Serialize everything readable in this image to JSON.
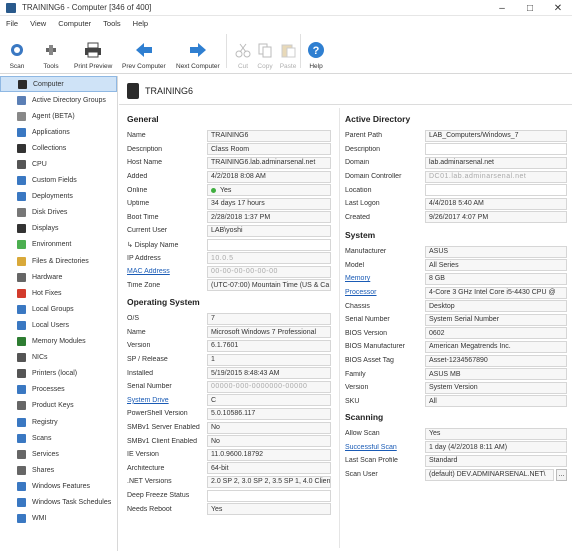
{
  "window": {
    "title": "TRAINING6 - Computer [346 of 400]",
    "minimize": "–",
    "maximize": "□",
    "close": "✕"
  },
  "menu": [
    "File",
    "View",
    "Computer",
    "Tools",
    "Help"
  ],
  "ribbon": {
    "scan": "Scan",
    "tools": "Tools",
    "print_preview": "Print Preview",
    "prev": "Prev Computer",
    "next": "Next Computer",
    "cut": "Cut",
    "copy": "Copy",
    "paste": "Paste",
    "help": "Help"
  },
  "sidebar": {
    "items": [
      {
        "label": "Computer",
        "color": "#2b2b2b"
      },
      {
        "label": "Active Directory Groups",
        "color": "#5b7fb5"
      },
      {
        "label": "Agent (BETA)",
        "color": "#888888"
      },
      {
        "label": "Applications",
        "color": "#3a78c2"
      },
      {
        "label": "Collections",
        "color": "#333333"
      },
      {
        "label": "CPU",
        "color": "#555555"
      },
      {
        "label": "Custom Fields",
        "color": "#3a78c2"
      },
      {
        "label": "Deployments",
        "color": "#3a78c2"
      },
      {
        "label": "Disk Drives",
        "color": "#777777"
      },
      {
        "label": "Displays",
        "color": "#333333"
      },
      {
        "label": "Environment",
        "color": "#4caf50"
      },
      {
        "label": "Files & Directories",
        "color": "#d9a93a"
      },
      {
        "label": "Hardware",
        "color": "#666666"
      },
      {
        "label": "Hot Fixes",
        "color": "#d33b2c"
      },
      {
        "label": "Local Groups",
        "color": "#3a78c2"
      },
      {
        "label": "Local Users",
        "color": "#3a78c2"
      },
      {
        "label": "Memory Modules",
        "color": "#2e7d32"
      },
      {
        "label": "NICs",
        "color": "#555555"
      },
      {
        "label": "Printers (local)",
        "color": "#555555"
      },
      {
        "label": "Processes",
        "color": "#3a78c2"
      },
      {
        "label": "Product Keys",
        "color": "#666666"
      },
      {
        "label": "Registry",
        "color": "#3a78c2"
      },
      {
        "label": "Scans",
        "color": "#3a78c2"
      },
      {
        "label": "Services",
        "color": "#666666"
      },
      {
        "label": "Shares",
        "color": "#666666"
      },
      {
        "label": "Windows Features",
        "color": "#3a78c2"
      },
      {
        "label": "Windows Task Schedules",
        "color": "#3a78c2"
      },
      {
        "label": "WMI",
        "color": "#3a78c2"
      }
    ]
  },
  "header": {
    "computer_name": "TRAINING6"
  },
  "general": {
    "title": "General",
    "rows": [
      {
        "label": "Name",
        "value": "TRAINING6"
      },
      {
        "label": "Description",
        "value": "Class Room"
      },
      {
        "label": "Host Name",
        "value": "TRAINING6.lab.adminarsenal.net"
      },
      {
        "label": "Added",
        "value": "4/2/2018 8:08 AM"
      },
      {
        "label": "Online",
        "value": "Yes"
      },
      {
        "label": "Uptime",
        "value": "34 days 17 hours"
      },
      {
        "label": "Boot Time",
        "value": "2/28/2018 1:37 PM"
      },
      {
        "label": "Current User",
        "value": "LAB\\yoshi"
      },
      {
        "label": "↳ Display Name",
        "value": ""
      },
      {
        "label": "IP Address",
        "value": "10.0.5"
      },
      {
        "label": "MAC Address",
        "value": "00-00-00-00-00-00"
      },
      {
        "label": "Time Zone",
        "value": "(UTC-07:00) Mountain Time (US & Ca"
      }
    ]
  },
  "os": {
    "title": "Operating System",
    "rows": [
      {
        "label": "O/S",
        "value": "7"
      },
      {
        "label": "Name",
        "value": "Microsoft Windows 7 Professional"
      },
      {
        "label": "Version",
        "value": "6.1.7601"
      },
      {
        "label": "SP / Release",
        "value": "1"
      },
      {
        "label": "Installed",
        "value": "5/19/2015 8:48:43 AM"
      },
      {
        "label": "Serial Number",
        "value": "00000-000-0000000-00000"
      },
      {
        "label": "System Drive",
        "value": "C"
      },
      {
        "label": "PowerShell Version",
        "value": "5.0.10586.117"
      },
      {
        "label": "SMBv1 Server Enabled",
        "value": "No"
      },
      {
        "label": "SMBv1 Client Enabled",
        "value": "No"
      },
      {
        "label": "IE Version",
        "value": "11.0.9600.18792"
      },
      {
        "label": "Architecture",
        "value": "64-bit"
      },
      {
        "label": ".NET Versions",
        "value": "2.0 SP 2, 3.0 SP 2, 3.5 SP 1, 4.0 Client,"
      },
      {
        "label": "Deep Freeze Status",
        "value": ""
      },
      {
        "label": "Needs Reboot",
        "value": "Yes"
      }
    ]
  },
  "ad": {
    "title": "Active Directory",
    "rows": [
      {
        "label": "Parent Path",
        "value": "LAB_Computers/Windows_7"
      },
      {
        "label": "Description",
        "value": ""
      },
      {
        "label": "Domain",
        "value": "lab.adminarsenal.net"
      },
      {
        "label": "Domain Controller",
        "value": "DC01.lab.adminarsenal.net"
      },
      {
        "label": "Location",
        "value": ""
      },
      {
        "label": "Last Logon",
        "value": "4/4/2018 5:40 AM"
      },
      {
        "label": "Created",
        "value": "9/26/2017 4:07 PM"
      }
    ]
  },
  "system": {
    "title": "System",
    "rows": [
      {
        "label": "Manufacturer",
        "value": "ASUS"
      },
      {
        "label": "Model",
        "value": "All Series"
      },
      {
        "label": "Memory",
        "value": "8 GB"
      },
      {
        "label": "Processor",
        "value": "4-Core 3 GHz Intel Core i5-4430 CPU @"
      },
      {
        "label": "Chassis",
        "value": "Desktop"
      },
      {
        "label": "Serial Number",
        "value": "System Serial Number"
      },
      {
        "label": "BIOS Version",
        "value": "0602"
      },
      {
        "label": "BIOS Manufacturer",
        "value": "American Megatrends Inc."
      },
      {
        "label": "BIOS Asset Tag",
        "value": "Asset-1234567890"
      },
      {
        "label": "Family",
        "value": "ASUS MB"
      },
      {
        "label": "Version",
        "value": "System Version"
      },
      {
        "label": "SKU",
        "value": "All"
      }
    ]
  },
  "scanning": {
    "title": "Scanning",
    "rows": [
      {
        "label": "Allow Scan",
        "value": "Yes"
      },
      {
        "label": "Successful Scan",
        "value": "1 day (4/2/2018 8:11 AM)"
      },
      {
        "label": "Last Scan Profile",
        "value": "Standard"
      },
      {
        "label": "Scan User",
        "value": "(default)  DEV.ADMINARSENAL.NET\\"
      }
    ],
    "ellipsis": "..."
  }
}
